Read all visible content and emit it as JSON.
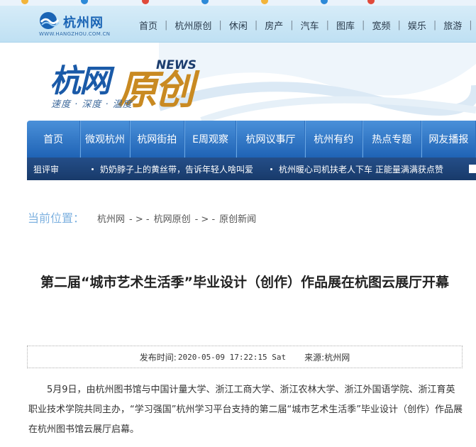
{
  "site": {
    "logo_name": "杭州网",
    "logo_url": "WWW.HANGZHOU.COM.CN",
    "nav": [
      "首页",
      "杭州原创",
      "休闲",
      "房产",
      "汽车",
      "图库",
      "宽频",
      "娱乐",
      "旅游"
    ]
  },
  "banner": {
    "title_main": "杭网",
    "title_accent": "原创",
    "title_badge": "NEWS",
    "slogan": "速度 · 深度 · 温度"
  },
  "main_nav": [
    "首页",
    "微观杭州",
    "杭网街拍",
    "E周观察",
    "杭网议事厅",
    "杭州有约",
    "热点专题",
    "网友播报"
  ],
  "ticker": {
    "label": "狙评审",
    "items": [
      "奶奶脖子上的黄丝带，告诉年轻人啥叫爱",
      "杭州暖心司机扶老人下车 正能量满满获点赞"
    ]
  },
  "breadcrumb": {
    "lead": "当前位置：",
    "items": [
      "杭州网",
      "杭网原创",
      "原创新闻"
    ],
    "separator": "- > -"
  },
  "article": {
    "title": "第二届“城市艺术生活季”毕业设计（创作）作品展在杭图云展厅开幕",
    "publish_label": "发布时间:",
    "publish_time": "2020-05-09 17:22:15 Sat",
    "source_label": "来源:",
    "source": "杭州网",
    "paragraph": "5月9日，由杭州图书馆与中国计量大学、浙江工商大学、浙江农林大学、浙江外国语学院、浙江育英职业技术学院共同主办，“学习强国”杭州学习平台支持的第二届“城市艺术生活季”毕业设计（创作）作品展在杭州图书馆云展厅启幕。"
  },
  "colors": {
    "nav_blue": "#1f63b5",
    "ticker_blue": "#183a6a",
    "banner_blue": "#1a5aa8",
    "banner_gold": "#c98a22",
    "crumb_lead": "#7fb2e0"
  }
}
